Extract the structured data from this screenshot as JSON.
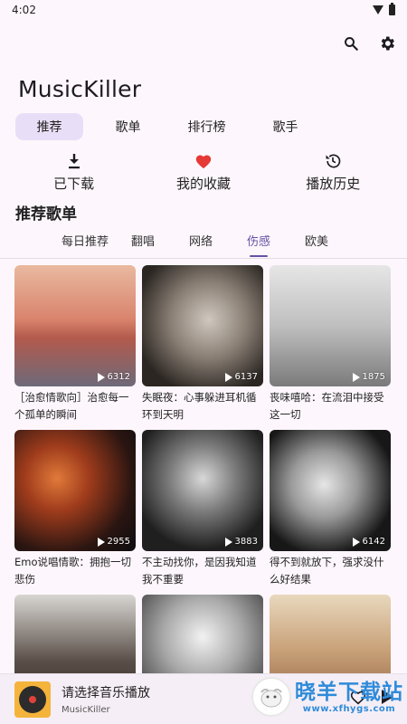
{
  "status": {
    "time": "4:02"
  },
  "app": {
    "title": "MusicKiller"
  },
  "icons": {
    "search": "search-icon",
    "settings": "gear-icon"
  },
  "main_tabs": [
    {
      "label": "推荐",
      "active": true
    },
    {
      "label": "歌单",
      "active": false
    },
    {
      "label": "排行榜",
      "active": false
    },
    {
      "label": "歌手",
      "active": false
    }
  ],
  "quick_actions": [
    {
      "label": "已下载",
      "icon": "download-icon"
    },
    {
      "label": "我的收藏",
      "icon": "heart-icon"
    },
    {
      "label": "播放历史",
      "icon": "history-icon"
    }
  ],
  "section": {
    "title": "推荐歌单"
  },
  "sub_tabs": [
    {
      "label": "每日推荐",
      "active": false
    },
    {
      "label": "翻唱",
      "active": false
    },
    {
      "label": "网络",
      "active": false
    },
    {
      "label": "伤感",
      "active": true
    },
    {
      "label": "欧美",
      "active": false
    }
  ],
  "playlists": [
    {
      "title": "［治愈情歌向］治愈每一个孤单的瞬间",
      "count": "6312"
    },
    {
      "title": "失眠夜：心事躲进耳机循环到天明",
      "count": "6137"
    },
    {
      "title": "丧味嘻哈：在流泪中接受这一切",
      "count": "1875"
    },
    {
      "title": "Emo说唱情歌：拥抱一切悲伤",
      "count": "2955"
    },
    {
      "title": "不主动找你，是因我知道我不重要",
      "count": "3883"
    },
    {
      "title": "得不到就放下，强求没什么好结果",
      "count": "6142"
    },
    {
      "title": "",
      "count": ""
    },
    {
      "title": "",
      "count": ""
    },
    {
      "title": "",
      "count": ""
    }
  ],
  "player": {
    "title": "请选择音乐播放",
    "subtitle": "MusicKiller"
  },
  "watermark": {
    "cn": "晓羊下载站",
    "url": "www.xfhygs.com"
  },
  "colors": {
    "accent": "#6750a4",
    "tab_active_bg": "#e9def7",
    "heart": "#e53935"
  }
}
